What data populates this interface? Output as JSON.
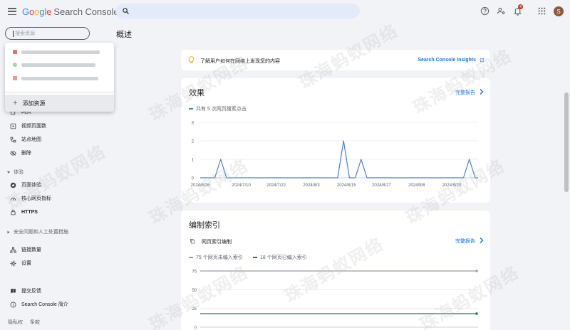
{
  "app": {
    "logo_google": [
      "G",
      "o",
      "o",
      "g",
      "l",
      "e"
    ],
    "logo_product": "Search Console"
  },
  "header": {
    "notif_count": "4",
    "avatar_letter": "S"
  },
  "sidebar": {
    "property_search_placeholder": "搜索资源",
    "dropdown_add": "添加资源",
    "items_top": [
      {
        "label": "网页",
        "icon": "pages-icon"
      },
      {
        "label": "视频页面数",
        "icon": "video-icon"
      },
      {
        "label": "站点地图",
        "icon": "sitemap-icon"
      },
      {
        "label": "删除",
        "icon": "removal-icon"
      }
    ],
    "section_experience": "体验",
    "items_experience": [
      {
        "label": "页面体验",
        "icon": "page-experience-icon"
      },
      {
        "label": "核心网页指标",
        "icon": "core-web-vitals-icon"
      },
      {
        "label": "HTTPS",
        "icon": "lock-icon"
      }
    ],
    "section_security": "安全问题和人工处置措施",
    "items_bottom": [
      {
        "label": "链接数量",
        "icon": "links-icon"
      },
      {
        "label": "设置",
        "icon": "settings-icon"
      }
    ],
    "items_footer": [
      {
        "label": "提交反馈",
        "icon": "feedback-icon"
      },
      {
        "label": "Search Console 简介",
        "icon": "info-icon"
      }
    ],
    "footer_links": [
      "隐私权",
      "条款"
    ]
  },
  "main": {
    "page_title": "概述",
    "insights_text": "了解用户如何在网络上发现您的内容",
    "insights_link": "Search Console Insights",
    "performance": {
      "title": "效果",
      "link": "完整报告",
      "legend": "共有 5 次网页搜索点击"
    },
    "indexing": {
      "title": "编制索引",
      "subtitle": "网页索引编制",
      "link": "完整报告",
      "legend_not_indexed": "75 个网页未编入索引",
      "legend_indexed": "18 个网页已编入索引"
    }
  },
  "colors": {
    "accent": "#1a73e8",
    "line_clicks": "#4a7fd8",
    "line_not_indexed": "#9aa0a6",
    "line_indexed": "#188038"
  },
  "chart_data": [
    {
      "type": "line",
      "title": "",
      "xlabel": "",
      "ylabel": "",
      "ylim": [
        0,
        3
      ],
      "y_ticks": [
        0,
        1,
        2,
        3
      ],
      "x_tick_labels": [
        "2024/6/26",
        "2024/7/10",
        "2024/7/22",
        "2024/8/3",
        "2024/8/15",
        "2024/8/27",
        "2024/9/8",
        "2024/9/20"
      ],
      "x": [
        "2024/6/26",
        "2024/6/28",
        "2024/7/1",
        "2024/7/3",
        "2024/7/5",
        "2024/8/10",
        "2024/8/12",
        "2024/8/14",
        "2024/8/16",
        "2024/8/18",
        "2024/8/20",
        "2024/8/22",
        "2024/9/24",
        "2024/9/26",
        "2024/9/28",
        "2024/9/29"
      ],
      "series": [
        {
          "name": "共有 5 次网页搜索点击",
          "values": [
            0,
            0,
            0,
            1,
            0,
            0,
            0,
            2,
            0,
            0,
            1,
            0,
            0,
            1,
            0,
            0
          ]
        }
      ]
    },
    {
      "type": "line",
      "title": "",
      "xlabel": "",
      "ylabel": "",
      "ylim": [
        0,
        75
      ],
      "y_ticks": [
        0,
        25,
        50,
        75
      ],
      "series": [
        {
          "name": "75 个网页未编入索引",
          "values": [
            75,
            75
          ]
        },
        {
          "name": "18 个网页已编入索引",
          "values": [
            18,
            18
          ]
        }
      ]
    }
  ]
}
